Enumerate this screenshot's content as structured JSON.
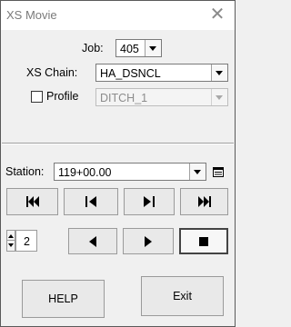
{
  "window": {
    "title": "XS Movie",
    "close_symbol": "✕"
  },
  "fields": {
    "job_label": "Job:",
    "job_value": "405",
    "xs_chain_label": "XS Chain:",
    "xs_chain_value": "HA_DSNCL",
    "profile_label": "Profile",
    "profile_value": "DITCH_1",
    "profile_checked": false
  },
  "station": {
    "label": "Station:",
    "value": "119+00.00"
  },
  "counter": {
    "value": "2"
  },
  "buttons": {
    "help": "HELP",
    "exit": "Exit"
  },
  "icons": {
    "nav": [
      "skip-to-first-icon",
      "step-back-icon",
      "step-forward-icon",
      "skip-to-last-icon"
    ],
    "play": [
      "play-reverse-icon",
      "play-forward-icon",
      "stop-icon"
    ]
  }
}
